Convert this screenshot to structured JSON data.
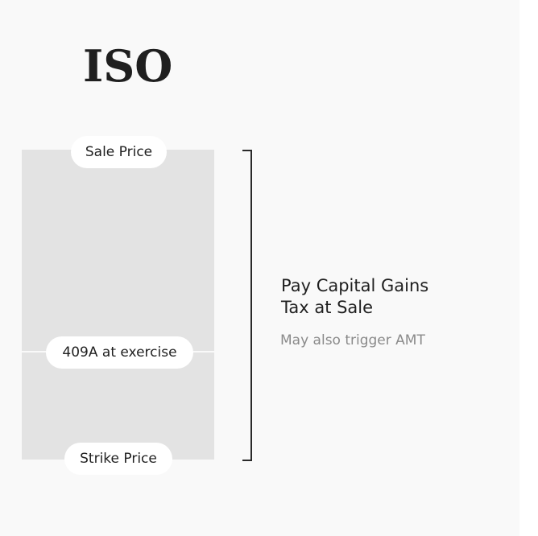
{
  "title": "ISO",
  "bar": {
    "top_label": "Sale Price",
    "middle_label": "409A at exercise",
    "bottom_label": "Strike Price"
  },
  "annotation": {
    "line1": "Pay Capital Gains",
    "line2": "Tax at Sale",
    "note": "May also trigger AMT"
  },
  "colors": {
    "background": "#f9f9f9",
    "bar": "#e3e3e3",
    "pill": "#ffffff",
    "text": "#1f1f1f",
    "muted_text": "#8a8a8a",
    "bracket": "#2a2a2a"
  }
}
